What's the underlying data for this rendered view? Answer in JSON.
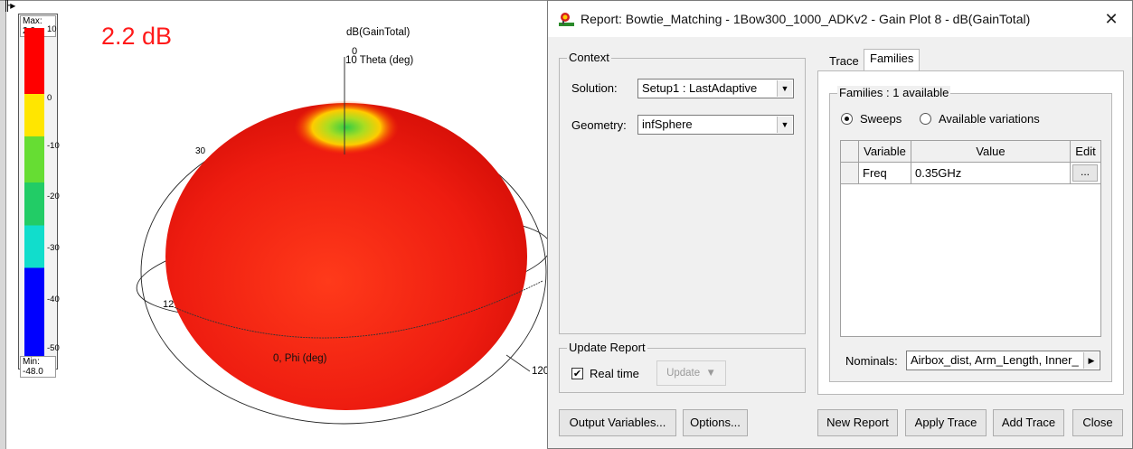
{
  "plot": {
    "big_label": "2.2 dB",
    "title": "dB(GainTotal)",
    "theta_zero": "0",
    "theta_label": "Theta (deg)",
    "theta_inner": "10",
    "phi_label": "0, Phi (deg)",
    "label_12": "12",
    "label_120": "120",
    "label_small": "30",
    "legend": {
      "max": "Max: 2.2",
      "min": "Min: -48.0",
      "ticks": [
        "10",
        "0",
        "-10",
        "-20",
        "-30",
        "-40",
        "-50"
      ],
      "colors": [
        "#ff0000",
        "#ffe600",
        "#66dd33",
        "#22cc66",
        "#11ddcc",
        "#0000ff"
      ]
    }
  },
  "dialog": {
    "title": "Report: Bowtie_Matching - 1Bow300_1000_ADKv2 - Gain Plot 8 - dB(GainTotal)",
    "close_glyph": "✕",
    "context": {
      "label": "Context",
      "solution_label": "Solution:",
      "solution_value": "Setup1 : LastAdaptive",
      "geometry_label": "Geometry:",
      "geometry_value": "infSphere"
    },
    "update": {
      "label": "Update Report",
      "realtime_label": "Real time",
      "realtime_checked": "✔",
      "update_button": "Update"
    },
    "tabs": [
      "Trace",
      "Families"
    ],
    "families": {
      "group_label": "Families : 1 available",
      "radio_sweeps": "Sweeps",
      "radio_variations": "Available variations",
      "headers": [
        "Variable",
        "Value",
        "Edit"
      ],
      "rows": [
        {
          "variable": "Freq",
          "value": "0.35GHz",
          "edit": "..."
        }
      ],
      "nominals_label": "Nominals:",
      "nominals_value": "Airbox_dist, Arm_Length, Inner_"
    },
    "buttons": {
      "output_variables": "Output Variables...",
      "options": "Options...",
      "new_report": "New Report",
      "apply_trace": "Apply Trace",
      "add_trace": "Add Trace",
      "close": "Close"
    }
  }
}
